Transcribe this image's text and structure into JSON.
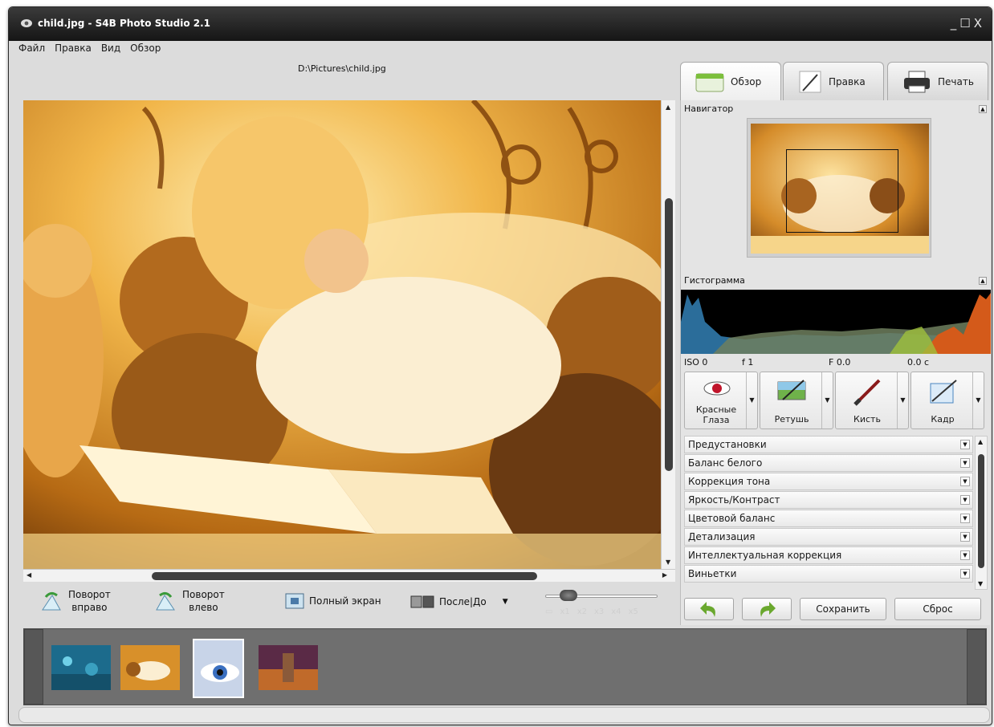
{
  "window": {
    "title": "child.jpg  -  S4B Photo Studio 2.1"
  },
  "menu": [
    "Файл",
    "Правка",
    "Вид",
    "Обзор"
  ],
  "file_path": "D:\\Pictures\\child.jpg",
  "tabs": [
    {
      "label": "Обзор",
      "icon": "browse-icon",
      "active": true
    },
    {
      "label": "Правка",
      "icon": "edit-pen-icon",
      "active": false
    },
    {
      "label": "Печать",
      "icon": "printer-icon",
      "active": false
    }
  ],
  "navigator": {
    "title": "Навигатор"
  },
  "histogram": {
    "title": "Гистограмма"
  },
  "exif": {
    "iso": "ISO 0",
    "f": "f 1",
    "F": "F 0.0",
    "shutter": "0.0 с"
  },
  "tools": [
    {
      "label": "Красные\nГлаза",
      "icon": "red-eye-icon"
    },
    {
      "label": "Ретушь",
      "icon": "retouch-icon"
    },
    {
      "label": "Кисть",
      "icon": "brush-icon"
    },
    {
      "label": "Кадр",
      "icon": "crop-icon"
    }
  ],
  "adjustments": [
    "Предустановки",
    "Баланс белого",
    "Коррекция тона",
    "Яркость/Контраст",
    "Цветовой баланс",
    "Детализация",
    "Интеллектуальная коррекция",
    "Виньетки"
  ],
  "actions": {
    "save": "Сохранить",
    "reset": "Сброс"
  },
  "toolbar": {
    "rotate_right_line1": "Поворот",
    "rotate_right_line2": "вправо",
    "rotate_left_line1": "Поворот",
    "rotate_left_line2": "влево",
    "fullscreen": "Полный экран",
    "before_after": "После|До"
  },
  "zoom": {
    "steps": [
      "x1",
      "x2",
      "x3",
      "x4",
      "x5"
    ],
    "level": 0.15
  },
  "colors": {
    "titlebar": "#1e1e1e",
    "panel": "#e4e4e4",
    "filmstrip": "#6f6f6f",
    "accent_green": "#6aa82e"
  },
  "filmstrip": [
    {
      "icon": "thumbnail-underwater"
    },
    {
      "icon": "thumbnail-child"
    },
    {
      "icon": "thumbnail-eye"
    },
    {
      "icon": "thumbnail-warrior"
    }
  ]
}
